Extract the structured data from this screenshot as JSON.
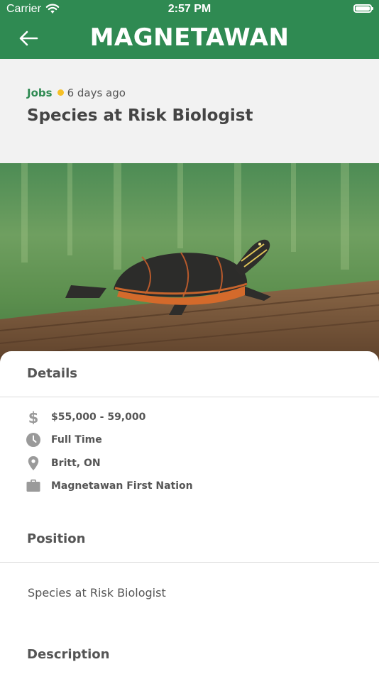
{
  "status_bar": {
    "carrier": "Carrier",
    "time": "2:57 PM"
  },
  "header": {
    "brand": "MAGNETAWAN",
    "back_icon": "arrow-left-icon"
  },
  "post": {
    "category": "Jobs",
    "posted": "6 days ago",
    "title": "Species at Risk Biologist"
  },
  "image": {
    "subject": "painted turtle basking on a log"
  },
  "details": {
    "heading": "Details",
    "salary": "$55,000 - 59,000",
    "type": "Full Time",
    "location": "Britt, ON",
    "employer": "Magnetawan First Nation"
  },
  "position": {
    "heading": "Position",
    "text": "Species at Risk Biologist"
  },
  "description": {
    "heading": "Description"
  },
  "colors": {
    "brand": "#2f8a52",
    "dot": "#f6c026",
    "text": "#555555",
    "icon": "#9a9a9a"
  }
}
